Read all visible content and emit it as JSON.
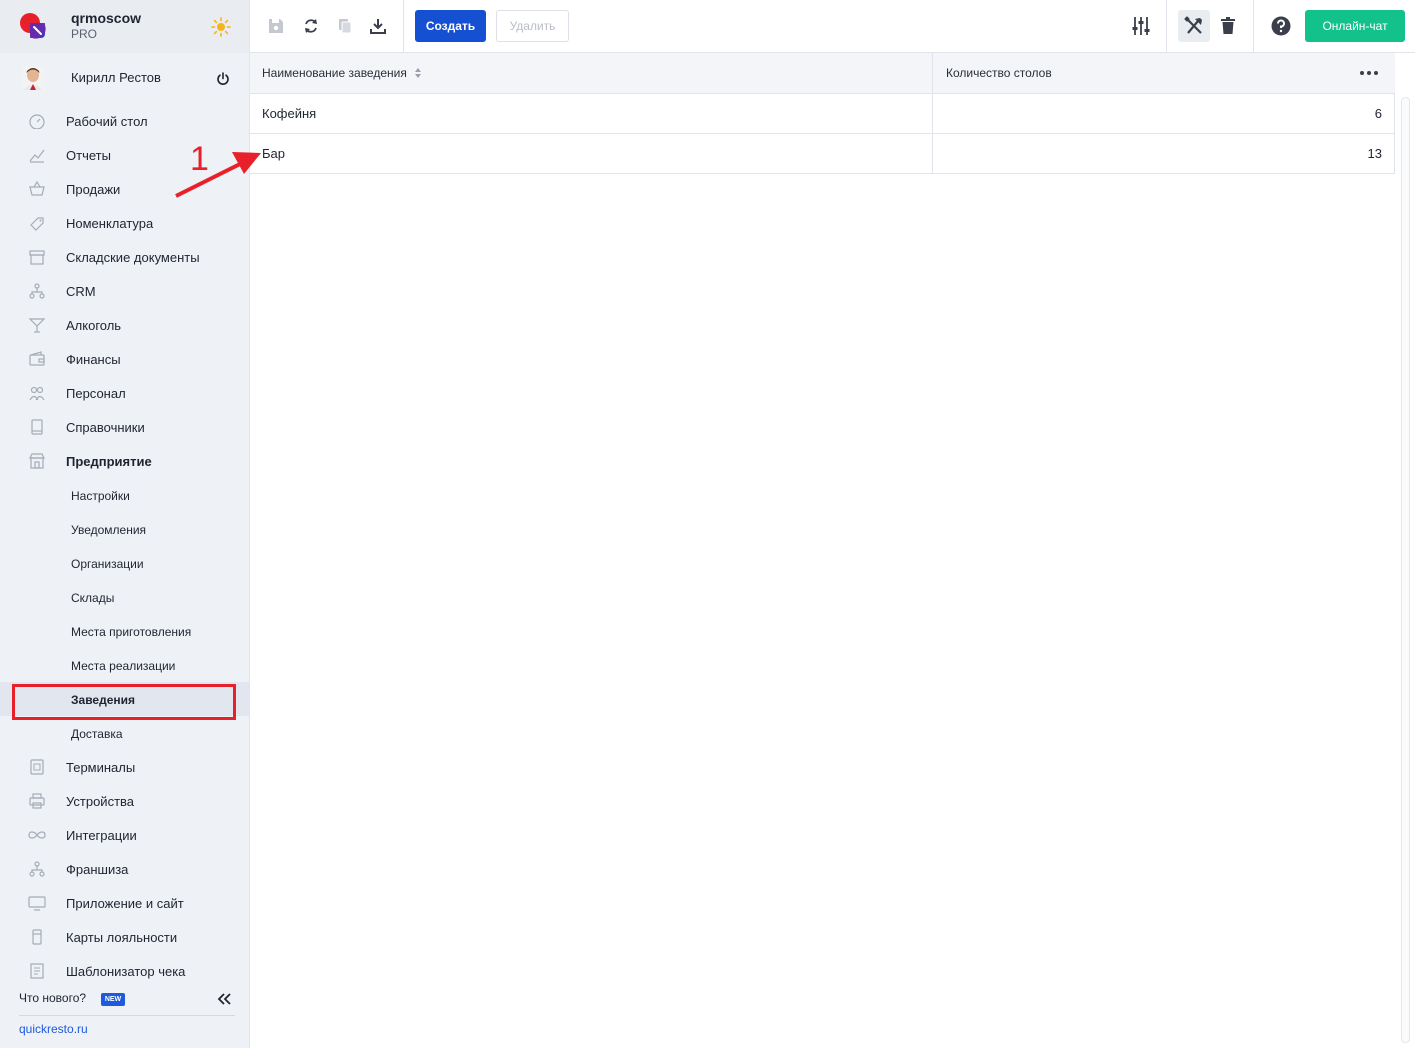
{
  "brand": {
    "name": "qrmoscow",
    "plan": "PRO"
  },
  "user": {
    "name": "Кирилл Рестов"
  },
  "sidebar": {
    "items": [
      {
        "label": "Рабочий стол",
        "icon": "dashboard-icon"
      },
      {
        "label": "Отчеты",
        "icon": "chart-icon"
      },
      {
        "label": "Продажи",
        "icon": "basket-icon"
      },
      {
        "label": "Номенклатура",
        "icon": "tag-icon"
      },
      {
        "label": "Складские документы",
        "icon": "archive-icon"
      },
      {
        "label": "CRM",
        "icon": "hierarchy-icon"
      },
      {
        "label": "Алкоголь",
        "icon": "cocktail-icon"
      },
      {
        "label": "Финансы",
        "icon": "wallet-icon"
      },
      {
        "label": "Персонал",
        "icon": "people-icon"
      },
      {
        "label": "Справочники",
        "icon": "book-icon"
      },
      {
        "label": "Предприятие",
        "icon": "store-icon"
      }
    ],
    "subitems": [
      {
        "label": "Настройки"
      },
      {
        "label": "Уведомления"
      },
      {
        "label": "Организации"
      },
      {
        "label": "Склады"
      },
      {
        "label": "Места приготовления"
      },
      {
        "label": "Места реализации"
      },
      {
        "label": "Заведения"
      },
      {
        "label": "Доставка"
      }
    ],
    "items_after": [
      {
        "label": "Терминалы",
        "icon": "qr-icon"
      },
      {
        "label": "Устройства",
        "icon": "printer-icon"
      },
      {
        "label": "Интеграции",
        "icon": "infinity-icon"
      },
      {
        "label": "Франшиза",
        "icon": "hierarchy-icon"
      },
      {
        "label": "Приложение и сайт",
        "icon": "monitor-icon"
      },
      {
        "label": "Карты лояльности",
        "icon": "card-icon"
      },
      {
        "label": "Шаблонизатор чека",
        "icon": "receipt-icon"
      }
    ],
    "whats_new": "Что нового?",
    "new_badge": "NEW",
    "footer_link": "quickresto.ru"
  },
  "toolbar": {
    "create_label": "Создать",
    "delete_label": "Удалить",
    "chat_label": "Онлайн-чат"
  },
  "table": {
    "columns": [
      "Наименование заведения",
      "Количество столов"
    ],
    "rows": [
      {
        "name": "Кофейня",
        "tables": "6"
      },
      {
        "name": "Бар",
        "tables": "13"
      }
    ]
  },
  "annotation": {
    "label": "1"
  },
  "colors": {
    "primary": "#1650d2",
    "success": "#12c28a",
    "highlight": "#e8202a",
    "sidebar_bg": "#eef1f6"
  }
}
